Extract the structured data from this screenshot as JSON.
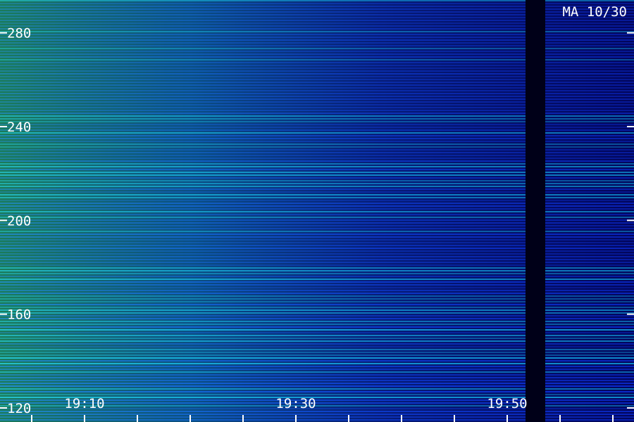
{
  "chart_data": {
    "type": "heatmap",
    "title": "MA 10/30",
    "xlabel": "",
    "ylabel": "",
    "x_ticks": [
      "19:10",
      "19:30",
      "19:50"
    ],
    "x_range": [
      "19:02",
      "19:62"
    ],
    "x_tick_minutes": [
      10,
      30,
      50
    ],
    "x_minor_step_minutes": 5,
    "y_ticks": [
      120,
      160,
      200,
      240,
      280
    ],
    "ylim": [
      114,
      294
    ],
    "colormap": [
      "#00003c",
      "#0a2ad8",
      "#10b0e8",
      "#40f040",
      "#f0f040"
    ],
    "grid": false
  }
}
